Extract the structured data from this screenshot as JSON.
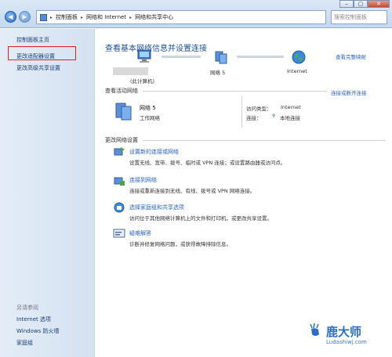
{
  "titlebar": {
    "breadcrumb": [
      "控制面板",
      "网络和 Internet",
      "网络和共享中心"
    ],
    "search_placeholder": "搜索控制面板",
    "minimize": "–",
    "maximize": "▢",
    "close": "✕"
  },
  "sidebar": {
    "home": "控制面板主页",
    "adapter": "更改适配器设置",
    "advanced": "更改高级共享设置",
    "see_also_title": "另请参阅",
    "see_also": [
      "Internet 选项",
      "Windows 防火墙",
      "家庭组"
    ]
  },
  "main": {
    "heading": "查看基本网络信息并设置连接",
    "map_link": "查看完整映射",
    "map": {
      "computer_label": "(此计算机)",
      "network_label": "网络  5",
      "internet_label": "Internet"
    },
    "active_section": "查看活动网络",
    "connect_link": "连接或断开连接",
    "network": {
      "name": "网络  5",
      "type": "工作网络",
      "access_type_label": "访问类型：",
      "access_type_value": "Internet",
      "connection_label": "连接：",
      "connection_value": "本地连接"
    },
    "change_section": "更改网络设置",
    "tasks": [
      {
        "title": "设置新的连接或网络",
        "desc": "设置无线、宽带、拨号、临时或 VPN 连接；或设置路由器或访问点。"
      },
      {
        "title": "连接到网络",
        "desc": "连接或重新连接到无线、有线、拨号或 VPN 网络连接。"
      },
      {
        "title": "选择家庭组和共享选项",
        "desc": "访问位于其他网络计算机上的文件和打印机，或更改共享设置。"
      },
      {
        "title": "疑难解答",
        "desc": "诊断并修复网络问题，或获得故障排除信息。"
      }
    ]
  },
  "watermark": {
    "main": "鹿大师",
    "sub": "Ludashiwj.com"
  },
  "colors": {
    "link": "#2b63c0",
    "heading": "#1f4f8f",
    "highlight_box": "#e02020"
  }
}
